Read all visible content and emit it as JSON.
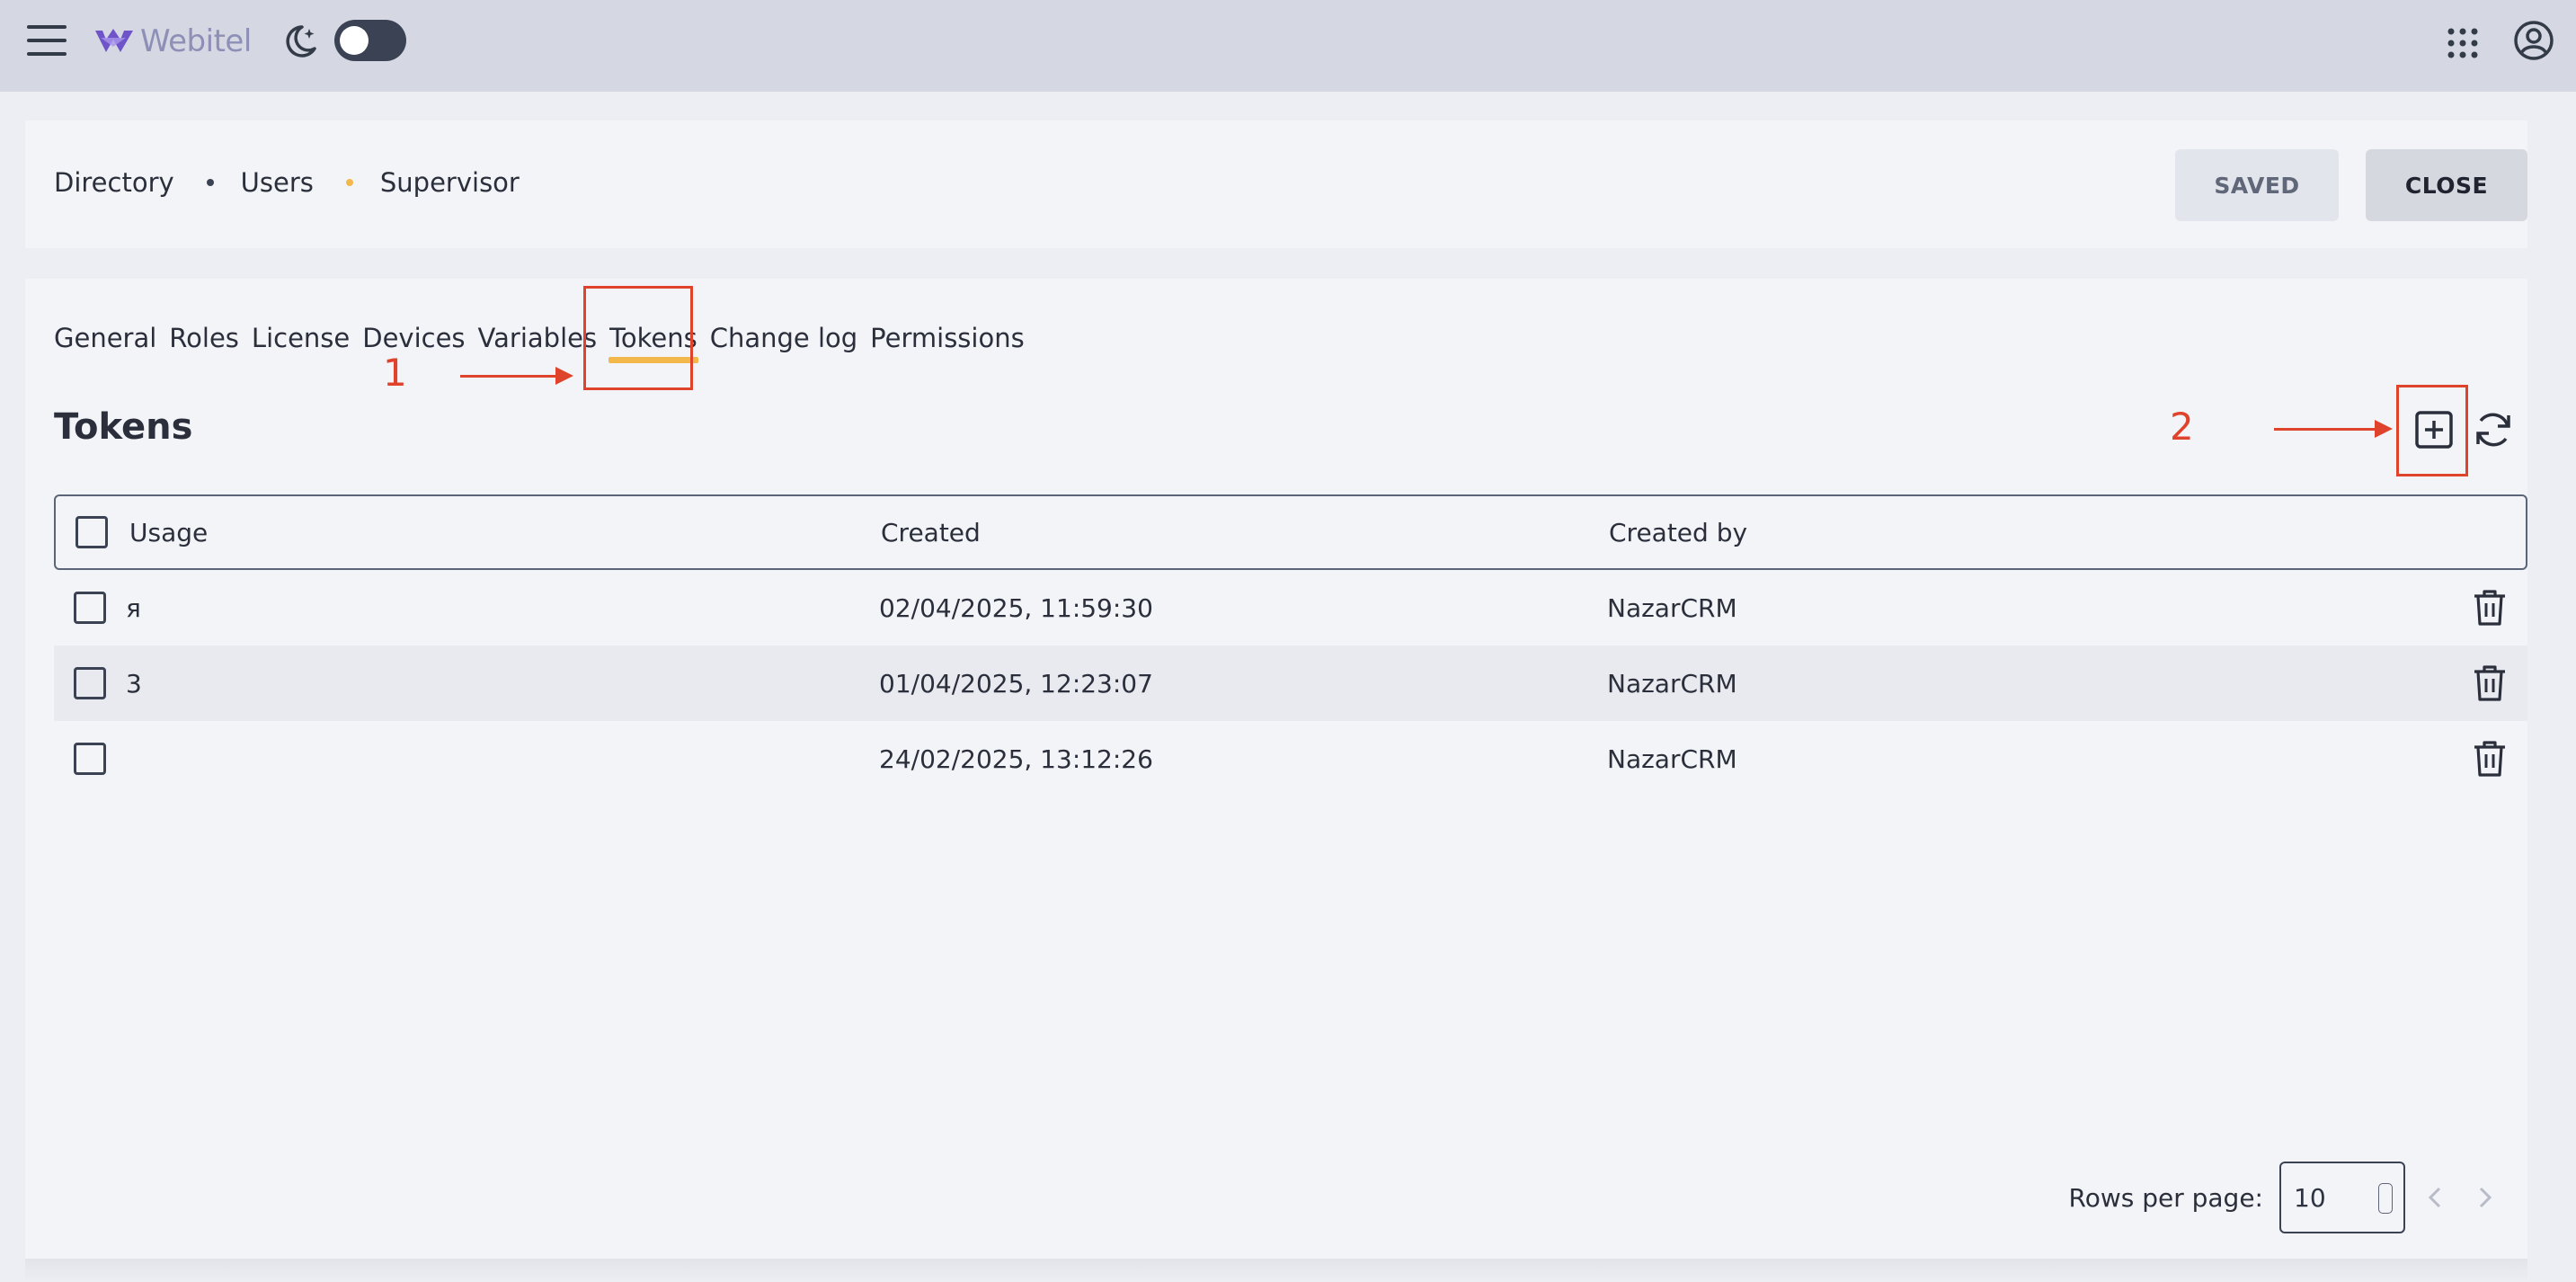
{
  "topbar": {
    "logo_text": "Webitel",
    "theme_toggle": "off"
  },
  "breadcrumb": {
    "items": [
      "Directory",
      "Users",
      "Supervisor"
    ],
    "dot_colors": [
      "#3a4254",
      "#f2b84b"
    ]
  },
  "header_actions": {
    "saved_label": "SAVED",
    "close_label": "CLOSE"
  },
  "tabs": [
    {
      "label": "General"
    },
    {
      "label": "Roles"
    },
    {
      "label": "License"
    },
    {
      "label": "Devices"
    },
    {
      "label": "Variables"
    },
    {
      "label": "Tokens",
      "active": true
    },
    {
      "label": "Change log"
    },
    {
      "label": "Permissions"
    }
  ],
  "annotations": {
    "step1": "1",
    "step2": "2",
    "color": "#e0432c"
  },
  "section": {
    "title": "Tokens"
  },
  "table": {
    "columns": [
      "Usage",
      "Created",
      "Created by"
    ],
    "rows": [
      {
        "usage": "я",
        "created": "02/04/2025, 11:59:30",
        "created_by": "NazarCRM"
      },
      {
        "usage": "3",
        "created": "01/04/2025, 12:23:07",
        "created_by": "NazarCRM"
      },
      {
        "usage": "",
        "created": "24/02/2025, 13:12:26",
        "created_by": "NazarCRM"
      }
    ]
  },
  "pagination": {
    "rows_per_page_label": "Rows per page:",
    "rows_per_page_value": "10"
  },
  "colors": {
    "accent": "#f2b84b",
    "topbar": "#d5d8e3",
    "annotation": "#e0432c"
  }
}
